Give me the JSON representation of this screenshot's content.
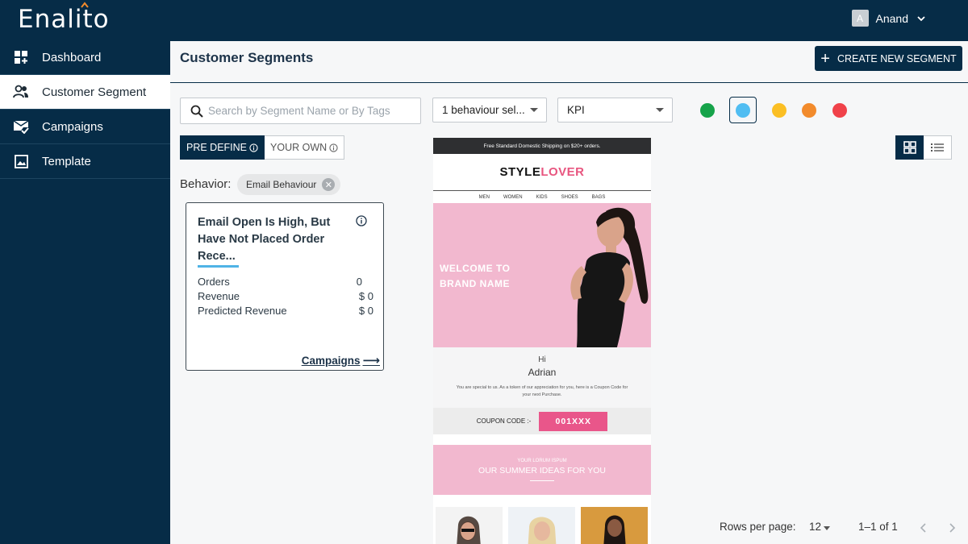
{
  "brand": {
    "logo_text": "Enalito"
  },
  "sidebar": {
    "items": [
      {
        "label": "Dashboard",
        "icon": "dashboard-icon",
        "active": false
      },
      {
        "label": "Customer Segment",
        "icon": "people-icon",
        "active": true
      },
      {
        "label": "Campaigns",
        "icon": "mail-check-icon",
        "active": false
      },
      {
        "label": "Template",
        "icon": "image-icon",
        "active": false
      }
    ]
  },
  "topbar": {
    "user_initial": "A",
    "user_name": "Anand"
  },
  "header": {
    "title": "Customer Segments",
    "create_label": "CREATE NEW SEGMENT"
  },
  "filters": {
    "search_placeholder": "Search by Segment Name or By Tags",
    "behaviour_select": "1 behaviour sel...",
    "kpi_select": "KPI",
    "color_dots": [
      "#16a34a",
      "#4fbdf2",
      "#fbbf24",
      "#f28b2c",
      "#f0424a"
    ],
    "selected_dot": 1
  },
  "segment_type": {
    "predefine_label": "PRE DEFINE",
    "own_label": "YOUR OWN",
    "selected": "PRE DEFINE"
  },
  "behavior": {
    "label": "Behavior:",
    "chip": "Email Behaviour"
  },
  "card": {
    "title": "Email Open Is High, But Have Not Placed Order Rece...",
    "rows": [
      {
        "label": "Orders",
        "value": "0"
      },
      {
        "label": "Revenue",
        "value": "$ 0"
      },
      {
        "label": "Predicted Revenue",
        "value": "$ 0"
      }
    ],
    "link": "Campaigns"
  },
  "template_preview": {
    "shipping_bar": "Free Standard Domestic Shipping on $20+ orders.",
    "brand_a": "STYLE",
    "brand_b": "LOVER",
    "menu": [
      "MEN",
      "WOMEN",
      "KIDS",
      "SHOES",
      "BAGS"
    ],
    "hero_line1": "WELCOME TO",
    "hero_line2": "BRAND NAME",
    "greeting": "Hi",
    "customer_name": "Adrian",
    "message": "You are special to us. As a token of our appreciation for you, here is a Coupon Code for your next Purchase.",
    "coupon_label": "COUPON CODE :-",
    "coupon_code": "001XXX",
    "summer_small": "YOUR LORUM ISPUM",
    "summer_title": "OUR SUMMER IDEAS FOR YOU"
  },
  "view": {
    "selected": "grid"
  },
  "pagination": {
    "rows_label": "Rows per page:",
    "rows_value": "12",
    "range": "1–1 of 1"
  }
}
